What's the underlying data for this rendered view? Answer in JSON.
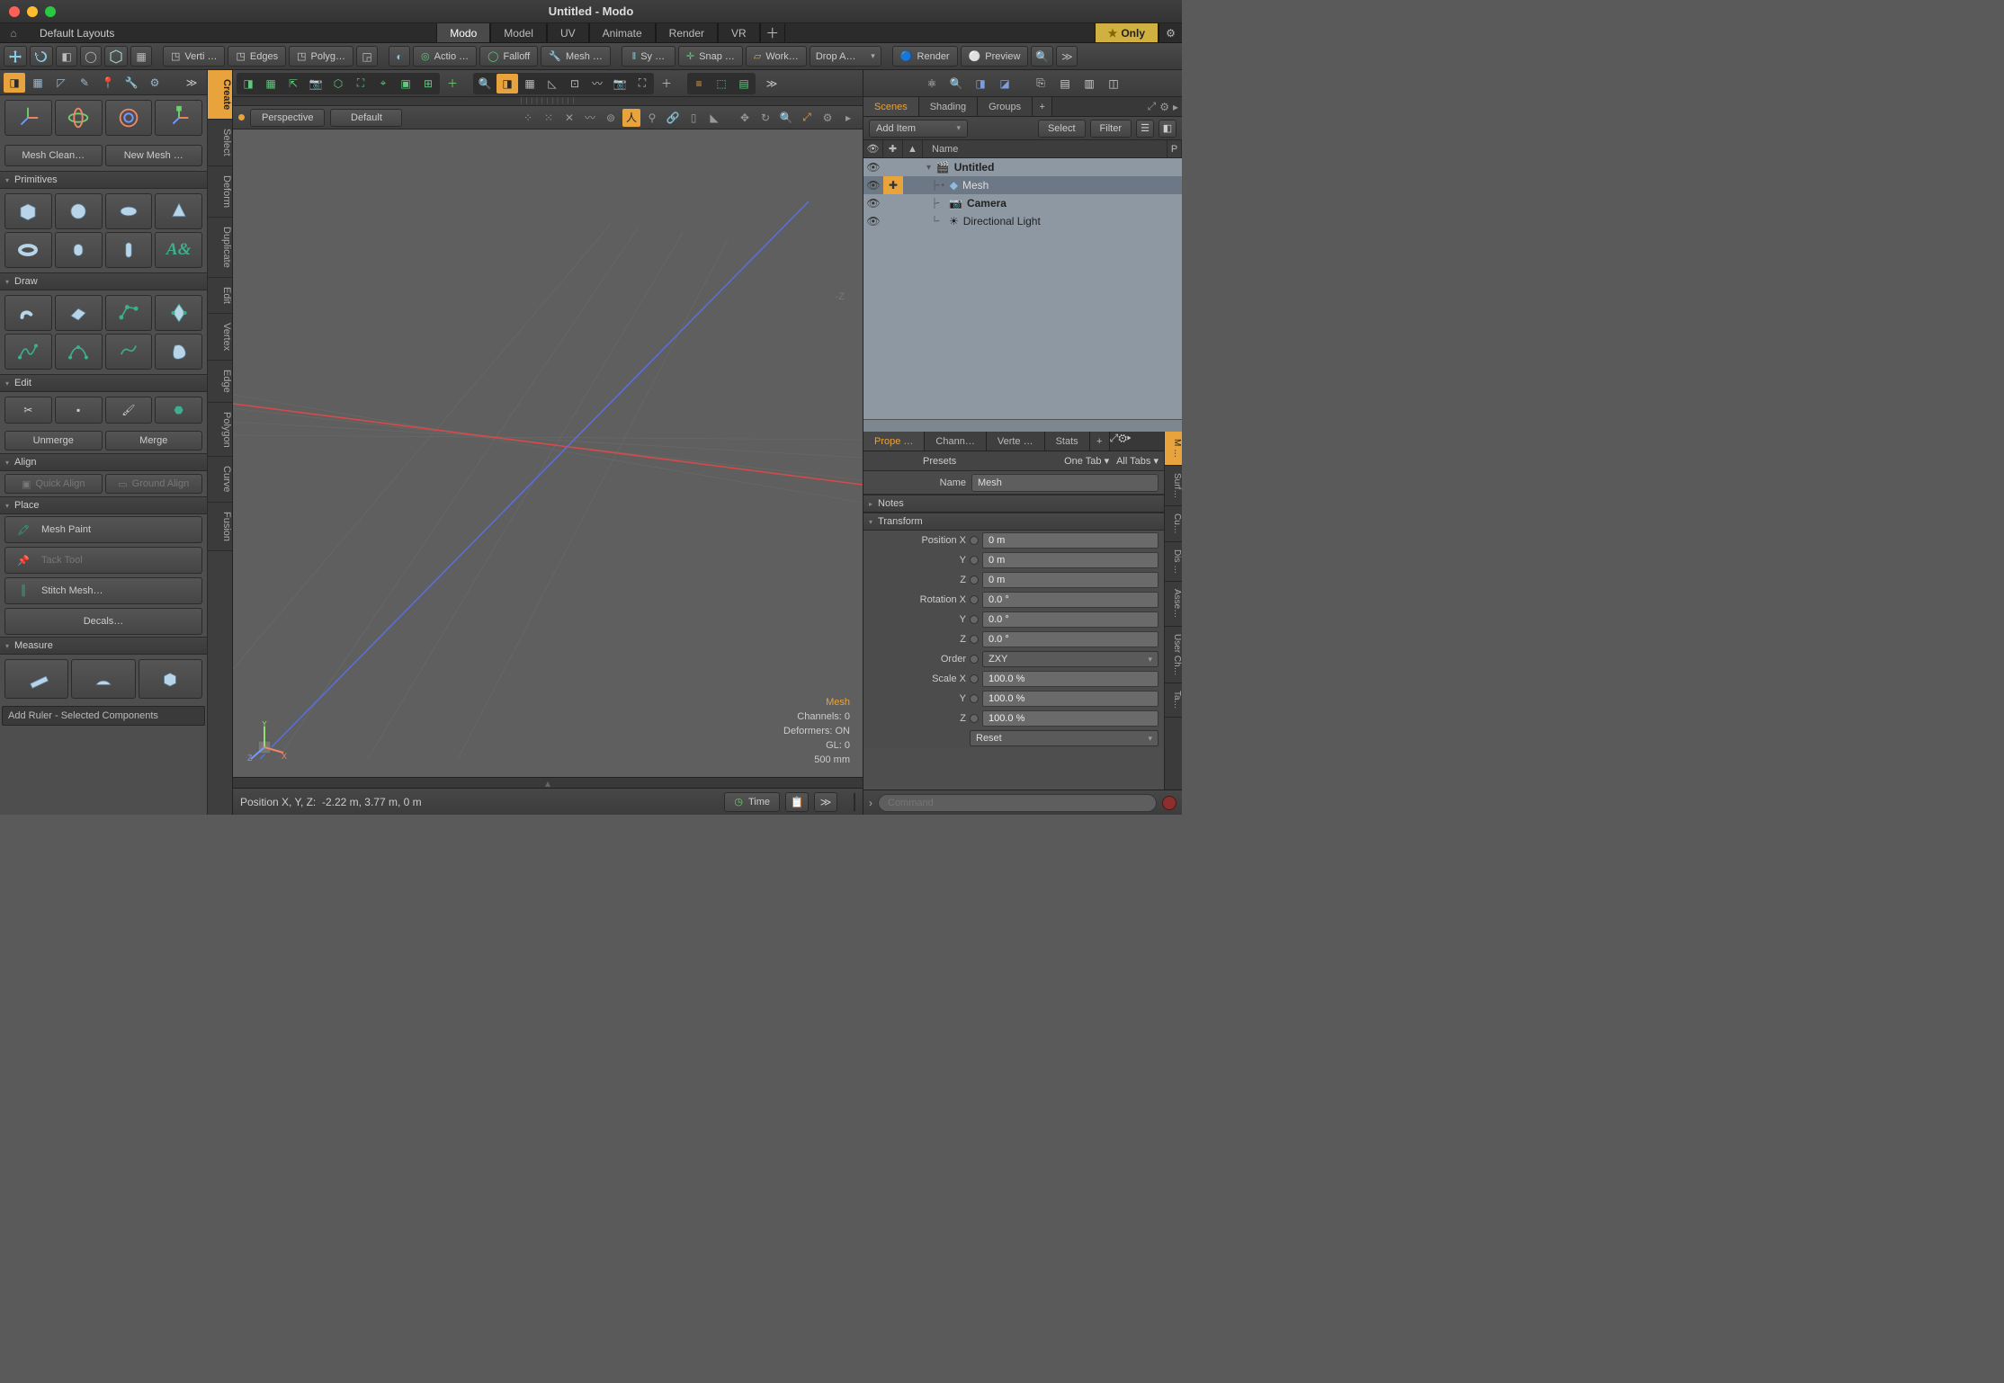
{
  "window": {
    "title": "Untitled - Modo"
  },
  "layoutbar": {
    "label": "Default Layouts",
    "tabs": [
      "Modo",
      "Model",
      "UV",
      "Animate",
      "Render",
      "VR"
    ],
    "active": 0,
    "only": "Only"
  },
  "main_toolbar": {
    "sel_modes": [
      "Verti …",
      "Edges",
      "Polyg…"
    ],
    "center_buttons": [
      "Actio …",
      "Falloff",
      "Mesh …",
      "Sy  …",
      "Snap …",
      "Work…"
    ],
    "drop": "Drop A…",
    "render": "Render",
    "preview": "Preview"
  },
  "left": {
    "micro_active": 0,
    "meshclean": "Mesh Clean…",
    "newmesh": "New Mesh …",
    "sections": {
      "primitives": "Primitives",
      "draw": "Draw",
      "edit": "Edit",
      "align": "Align",
      "place": "Place",
      "measure": "Measure"
    },
    "edit_buttons": [
      "Unmerge",
      "Merge"
    ],
    "align_buttons": [
      "Quick Align",
      "Ground Align"
    ],
    "place_items": [
      "Mesh Paint",
      "Tack Tool",
      "Stitch Mesh…",
      "Decals…"
    ],
    "footer": "Add Ruler - Selected Components",
    "vtabs": [
      "Create",
      "Select",
      "Deform",
      "Duplicate",
      "Edit",
      "Vertex",
      "Edge",
      "Polygon",
      "Curve",
      "Fusion"
    ]
  },
  "viewport": {
    "view": "Perspective",
    "shade": "Default",
    "zlabel": "-Z",
    "info_mesh": "Mesh",
    "info": [
      "Channels: 0",
      "Deformers: ON",
      "GL: 0",
      "500 mm"
    ],
    "status_prefix": "Position X, Y, Z:",
    "status_vals": "-2.22 m, 3.77 m, 0 m",
    "time": "Time"
  },
  "right": {
    "scene_tabs": [
      "Scenes",
      "Shading",
      "Groups"
    ],
    "add_item": "Add Item",
    "select": "Select",
    "filter": "Filter",
    "tree_header": "Name",
    "tree": [
      {
        "name": "Untitled",
        "bold": true,
        "icon": "scene",
        "indent": 0,
        "sel": false
      },
      {
        "name": "Mesh",
        "bold": false,
        "icon": "mesh",
        "indent": 1,
        "sel": true
      },
      {
        "name": "Camera",
        "bold": true,
        "icon": "camera",
        "indent": 1,
        "sel": false
      },
      {
        "name": "Directional Light",
        "bold": false,
        "icon": "light",
        "indent": 1,
        "sel": false
      }
    ],
    "prop_tabs": [
      "Prope …",
      "Chann…",
      "Verte …",
      "Stats"
    ],
    "prop_vtabs": [
      "M …",
      "Surf…",
      "Cu…",
      "Dis …",
      "Asse…",
      "User Ch…",
      "Ta…"
    ],
    "presets": "Presets",
    "onetab": "One Tab ▾",
    "alltabs": "All Tabs ▾",
    "name_label": "Name",
    "name_value": "Mesh",
    "notes": "Notes",
    "transform": "Transform",
    "rows": [
      {
        "label": "Position X",
        "value": "0 m"
      },
      {
        "label": "Y",
        "value": "0 m"
      },
      {
        "label": "Z",
        "value": "0 m"
      },
      {
        "label": "Rotation X",
        "value": "0.0 °"
      },
      {
        "label": "Y",
        "value": "0.0 °"
      },
      {
        "label": "Z",
        "value": "0.0 °"
      }
    ],
    "order_label": "Order",
    "order_value": "ZXY",
    "scale_rows": [
      {
        "label": "Scale X",
        "value": "100.0 %"
      },
      {
        "label": "Y",
        "value": "100.0 %"
      },
      {
        "label": "Z",
        "value": "100.0 %"
      }
    ],
    "reset": "Reset",
    "command_placeholder": "Command"
  }
}
